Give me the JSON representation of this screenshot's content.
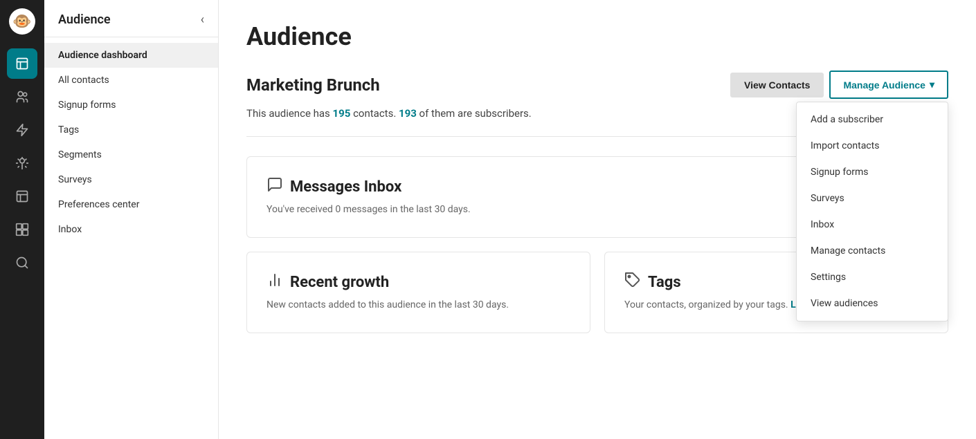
{
  "app": {
    "logo": "🐵"
  },
  "icon_sidebar": {
    "items": [
      {
        "id": "edit",
        "icon": "✏️",
        "active": true
      },
      {
        "id": "audience",
        "icon": "👥",
        "active": false
      },
      {
        "id": "campaigns",
        "icon": "⚡",
        "active": false
      },
      {
        "id": "automations",
        "icon": "👤",
        "active": false
      },
      {
        "id": "analytics",
        "icon": "📊",
        "active": false
      },
      {
        "id": "integrations",
        "icon": "⬛",
        "active": false
      },
      {
        "id": "search",
        "icon": "🔍",
        "active": false
      }
    ]
  },
  "left_sidebar": {
    "title": "Audience",
    "collapse_icon": "‹",
    "nav_items": [
      {
        "id": "audience-dashboard",
        "label": "Audience dashboard",
        "active": true
      },
      {
        "id": "all-contacts",
        "label": "All contacts",
        "active": false
      },
      {
        "id": "signup-forms",
        "label": "Signup forms",
        "active": false
      },
      {
        "id": "tags",
        "label": "Tags",
        "active": false
      },
      {
        "id": "segments",
        "label": "Segments",
        "active": false
      },
      {
        "id": "surveys",
        "label": "Surveys",
        "active": false
      },
      {
        "id": "preferences-center",
        "label": "Preferences center",
        "active": false
      },
      {
        "id": "inbox",
        "label": "Inbox",
        "active": false
      }
    ]
  },
  "main": {
    "page_title": "Audience",
    "audience_name": "Marketing Brunch",
    "audience_subtitle_prefix": "This audience has ",
    "contacts_count": "195",
    "audience_subtitle_middle": " contacts. ",
    "subscribers_count": "193",
    "audience_subtitle_suffix": " of them are subscribers.",
    "view_contacts_label": "View Contacts",
    "manage_audience_label": "Manage Audience",
    "manage_audience_chevron": "▾",
    "cards": {
      "inbox": {
        "title": "Messages Inbox",
        "desc": "You've received 0 messages in the last 30 days."
      },
      "recent_growth": {
        "title": "Recent growth",
        "desc": "New contacts added to this audience in the last 30 days."
      },
      "tags": {
        "title": "Tags",
        "desc": "Your contacts, organized by your tags. ",
        "link_label": "Learn more about tags"
      }
    }
  },
  "dropdown": {
    "items": [
      {
        "id": "add-subscriber",
        "label": "Add a subscriber"
      },
      {
        "id": "import-contacts",
        "label": "Import contacts"
      },
      {
        "id": "signup-forms",
        "label": "Signup forms"
      },
      {
        "id": "surveys",
        "label": "Surveys"
      },
      {
        "id": "inbox",
        "label": "Inbox"
      },
      {
        "id": "manage-contacts",
        "label": "Manage contacts"
      },
      {
        "id": "settings",
        "label": "Settings"
      },
      {
        "id": "view-audiences",
        "label": "View audiences"
      }
    ]
  }
}
